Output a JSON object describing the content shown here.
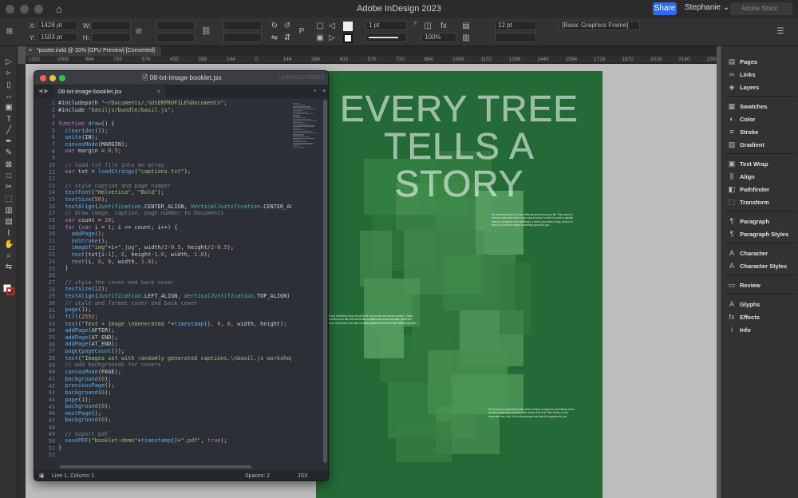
{
  "app": {
    "title": "Adobe InDesign 2023",
    "share_label": "Share",
    "user_name": "Stephanie",
    "stock_placeholder": "Adobe Stock"
  },
  "control_bar": {
    "x_label": "X:",
    "x_value": "1428 pt",
    "y_label": "Y:",
    "y_value": "1503 pt",
    "w_label": "W:",
    "h_label": "H:",
    "stroke_weight": "1 pt",
    "zoom": "100%",
    "fitting_value": "12 pt",
    "object_style": "[Basic Graphics Frame]"
  },
  "document": {
    "tab_label": "*poster.indd @ 20% [GPU Preview] [Converted]",
    "ruler_ticks": [
      "1152",
      "1008",
      "864",
      "720",
      "576",
      "432",
      "288",
      "144",
      "0",
      "144",
      "288",
      "432",
      "576",
      "720",
      "864",
      "1008",
      "1152",
      "1296",
      "1440",
      "1584",
      "1728",
      "1872",
      "2016",
      "2160",
      "2304"
    ]
  },
  "poster": {
    "headline_line1": "EVERY TREE",
    "headline_line2": "TELLS A STORY",
    "background_color": "#246a36",
    "body_text_1": "We would like you to tell us a little about a tree in your life. This can be a tree you saw every day on your way to school, a tree in a park or garden that you remember from childhood, a tree in your town or city, a tree in a story or a tree that means something special to you.",
    "body_text_2": "Every tree tells a story about its life, the people and places around it. Trees connect us to the past and future, to nature and to one another. Share the story of your tree and help us build a picture of the trees that matter to people.",
    "body_text_3": "Not every story associated with trees is based on legends and folklore; there are also many trees loved for their shade, their fruit, their flowers or the memories they hold. Tell us about yours and why it is important to you."
  },
  "editor": {
    "window_title": "08-txt-image-booklet.jsx",
    "unregistered": "UNREGISTERED",
    "tab_label": "08-txt-image-booklet.jsx",
    "status_position": "Line 1, Column 1",
    "status_spaces": "Spaces: 2",
    "status_syntax": "JSX"
  },
  "code_lines": [
    "#includepath \"~/Documents/;%USERPROFILE%Documents\";",
    "#include \"basiljs/bundle/basil.js\";",
    "",
    "function draw() {",
    "  clear(doc());",
    "  units(IN);",
    "  canvasMode(MARGIN);",
    "  var margin = 0.5;",
    "",
    "  // load txt file into an array",
    "  var txt = loadStrings(\"captions.txt\");",
    "",
    "  // style caption and page number",
    "  textFont(\"Helvetica\", \"Bold\");",
    "  textSize(50);",
    "  textAlign(Justification.CENTER_ALIGN, VerticalJustification.CENTER_ALIGN);",
    "  // draw image, caption, page number to Documents",
    "  var count = 20;",
    "  for (var i = 1; i <= count; i++) {",
    "    addPage();",
    "    noStroke();",
    "    image(\"img\"+i+\".jpg\", width/2-0.5, height/2-0.5);",
    "    text(txt[i-1], 0, height-1.0, width, 1.0);",
    "    text(i, 0, 0, width, 1.0);",
    "  }",
    "",
    "  // style the cover and back cover",
    "  textSize(12);",
    "  textAlign(Justification.LEFT_ALIGN, VerticalJustification.TOP_ALIGN);",
    "  // style and format cover and back cover",
    "  page(1);",
    "  fill(255);",
    "  text(\"Text + Image \\nGenerated \"+timestamp(), 0, 0, width, height);",
    "  addPage(AFTER);",
    "  addPage(AT_END);",
    "  addPage(AT_END);",
    "  page(pageCount());",
    "  text(\"Images set with randomly generated captions.\\nbasil.js workshop",
    "  // add backgrounds for covers",
    "  canvasMode(PAGE);",
    "  background(0);",
    "  previousPage();",
    "  background(0);",
    "  page(1);",
    "  background(0);",
    "  nextPage();",
    "  background(0);",
    "",
    "  // export pdf",
    "  savePDF(\"booklet-demo\"+timestamp()+\".pdf\", true);",
    "}",
    ""
  ],
  "panels": [
    {
      "label": "Pages",
      "icon": "pages-icon",
      "glyph": "▤"
    },
    {
      "label": "Links",
      "icon": "links-icon",
      "glyph": "∞"
    },
    {
      "label": "Layers",
      "icon": "layers-icon",
      "glyph": "◈"
    },
    {
      "label": "Swatches",
      "icon": "swatches-icon",
      "glyph": "▦"
    },
    {
      "label": "Color",
      "icon": "color-icon",
      "glyph": "◐"
    },
    {
      "label": "Stroke",
      "icon": "stroke-icon",
      "glyph": "≡"
    },
    {
      "label": "Gradient",
      "icon": "gradient-icon",
      "glyph": "▧"
    },
    {
      "label": "Text Wrap",
      "icon": "text-wrap-icon",
      "glyph": "▣"
    },
    {
      "label": "Align",
      "icon": "align-icon",
      "glyph": "⫼"
    },
    {
      "label": "Pathfinder",
      "icon": "pathfinder-icon",
      "glyph": "◧"
    },
    {
      "label": "Transform",
      "icon": "transform-icon",
      "glyph": "⬚"
    },
    {
      "label": "Paragraph",
      "icon": "paragraph-icon",
      "glyph": "¶"
    },
    {
      "label": "Paragraph Styles",
      "icon": "paragraph-styles-icon",
      "glyph": "¶"
    },
    {
      "label": "Character",
      "icon": "character-icon",
      "glyph": "A"
    },
    {
      "label": "Character Styles",
      "icon": "character-styles-icon",
      "glyph": "A"
    },
    {
      "label": "Review",
      "icon": "review-icon",
      "glyph": "▭"
    },
    {
      "label": "Glyphs",
      "icon": "glyphs-icon",
      "glyph": "A"
    },
    {
      "label": "Effects",
      "icon": "effects-icon",
      "glyph": "fx"
    },
    {
      "label": "Info",
      "icon": "info-icon",
      "glyph": "i"
    }
  ],
  "tools": [
    {
      "name": "selection-tool-icon",
      "glyph": "▷"
    },
    {
      "name": "direct-selection-tool-icon",
      "glyph": "▹"
    },
    {
      "name": "page-tool-icon",
      "glyph": "▯"
    },
    {
      "name": "gap-tool-icon",
      "glyph": "↔"
    },
    {
      "name": "content-collector-icon",
      "glyph": "▣"
    },
    {
      "name": "type-tool-icon",
      "glyph": "T"
    },
    {
      "name": "line-tool-icon",
      "glyph": "╱"
    },
    {
      "name": "pen-tool-icon",
      "glyph": "✒"
    },
    {
      "name": "pencil-tool-icon",
      "glyph": "✎"
    },
    {
      "name": "rectangle-frame-tool-icon",
      "glyph": "⊠"
    },
    {
      "name": "rectangle-tool-icon",
      "glyph": "□"
    },
    {
      "name": "scissors-tool-icon",
      "glyph": "✂"
    },
    {
      "name": "free-transform-tool-icon",
      "glyph": "⬚"
    },
    {
      "name": "gradient-tool-icon",
      "glyph": "▥"
    },
    {
      "name": "note-tool-icon",
      "glyph": "▤"
    },
    {
      "name": "eyedropper-tool-icon",
      "glyph": "⌇"
    },
    {
      "name": "hand-tool-icon",
      "glyph": "✋"
    },
    {
      "name": "zoom-tool-icon",
      "glyph": "⌕"
    },
    {
      "name": "fill-stroke-swap-icon",
      "glyph": "⇆"
    }
  ]
}
